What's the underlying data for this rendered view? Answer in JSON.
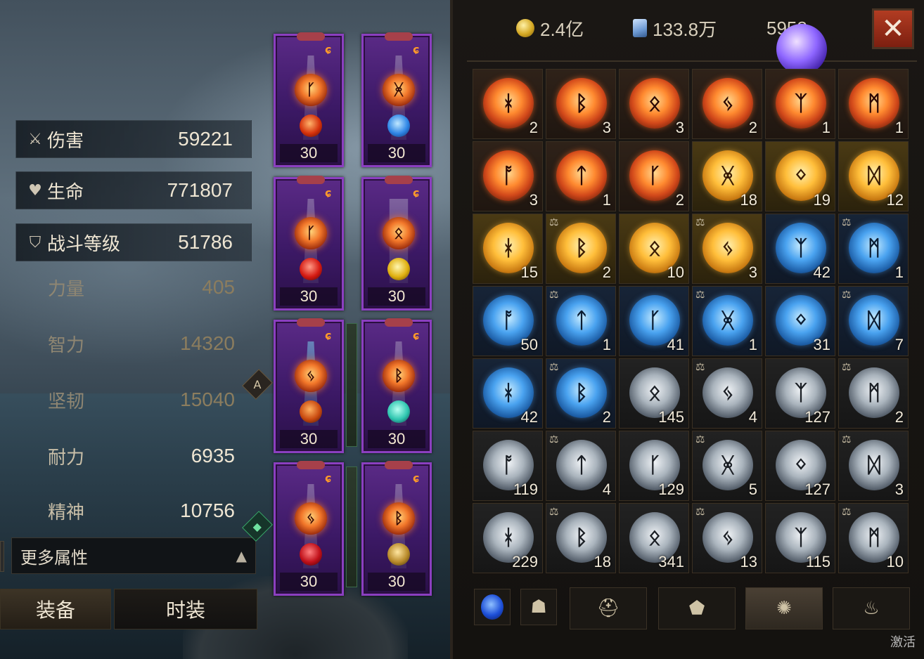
{
  "stats": {
    "main": [
      {
        "icon": "swords-icon",
        "label": "伤害",
        "value": "59221"
      },
      {
        "icon": "heart-icon",
        "label": "生命",
        "value": "771807"
      },
      {
        "icon": "shield-icon",
        "label": "战斗等级",
        "value": "51786"
      }
    ],
    "sub": [
      {
        "label": "力量",
        "value": "405",
        "dim": true
      },
      {
        "label": "智力",
        "value": "14320",
        "dim": true
      },
      {
        "label": "坚韧",
        "value": "15040",
        "dim": true
      },
      {
        "label": "耐力",
        "value": "6935",
        "dim": false
      },
      {
        "label": "精神",
        "value": "10756",
        "dim": false
      }
    ],
    "more_label": "更多属性"
  },
  "tabs": {
    "equip": "装备",
    "fashion": "时装"
  },
  "equipment": {
    "levels": [
      "30",
      "30",
      "30",
      "30",
      "30",
      "30",
      "30",
      "30"
    ],
    "side_tab_label": "A"
  },
  "currency": {
    "gold": "2.4亿",
    "card": "133.8万",
    "orb": "5958"
  },
  "close_label": "✕",
  "runes": [
    {
      "color": "red",
      "count": "2",
      "locked": false
    },
    {
      "color": "red",
      "count": "3",
      "locked": false
    },
    {
      "color": "red",
      "count": "3",
      "locked": false
    },
    {
      "color": "red",
      "count": "2",
      "locked": false
    },
    {
      "color": "red",
      "count": "1",
      "locked": false
    },
    {
      "color": "red",
      "count": "1",
      "locked": false
    },
    {
      "color": "red",
      "count": "3",
      "locked": false
    },
    {
      "color": "red",
      "count": "1",
      "locked": false
    },
    {
      "color": "red",
      "count": "2",
      "locked": false
    },
    {
      "color": "gold",
      "count": "18",
      "locked": false
    },
    {
      "color": "gold",
      "count": "19",
      "locked": false
    },
    {
      "color": "gold",
      "count": "12",
      "locked": false
    },
    {
      "color": "gold",
      "count": "15",
      "locked": false
    },
    {
      "color": "gold",
      "count": "2",
      "locked": true
    },
    {
      "color": "gold",
      "count": "10",
      "locked": false
    },
    {
      "color": "gold",
      "count": "3",
      "locked": true
    },
    {
      "color": "blue",
      "count": "42",
      "locked": false
    },
    {
      "color": "blue",
      "count": "1",
      "locked": true
    },
    {
      "color": "blue",
      "count": "50",
      "locked": false
    },
    {
      "color": "blue",
      "count": "1",
      "locked": true
    },
    {
      "color": "blue",
      "count": "41",
      "locked": false
    },
    {
      "color": "blue",
      "count": "1",
      "locked": true
    },
    {
      "color": "blue",
      "count": "31",
      "locked": false
    },
    {
      "color": "blue",
      "count": "7",
      "locked": true
    },
    {
      "color": "blue",
      "count": "42",
      "locked": false
    },
    {
      "color": "blue",
      "count": "2",
      "locked": true
    },
    {
      "color": "grey",
      "count": "145",
      "locked": false
    },
    {
      "color": "grey",
      "count": "4",
      "locked": true
    },
    {
      "color": "grey",
      "count": "127",
      "locked": false
    },
    {
      "color": "grey",
      "count": "2",
      "locked": true
    },
    {
      "color": "grey",
      "count": "119",
      "locked": false
    },
    {
      "color": "grey",
      "count": "4",
      "locked": true
    },
    {
      "color": "grey",
      "count": "129",
      "locked": false
    },
    {
      "color": "grey",
      "count": "5",
      "locked": true
    },
    {
      "color": "grey",
      "count": "127",
      "locked": false
    },
    {
      "color": "grey",
      "count": "3",
      "locked": true
    },
    {
      "color": "grey",
      "count": "229",
      "locked": false
    },
    {
      "color": "grey",
      "count": "18",
      "locked": true
    },
    {
      "color": "grey",
      "count": "341",
      "locked": false
    },
    {
      "color": "grey",
      "count": "13",
      "locked": true
    },
    {
      "color": "grey",
      "count": "115",
      "locked": false
    },
    {
      "color": "grey",
      "count": "10",
      "locked": true
    }
  ],
  "bottom_icons": [
    "blue-orb-icon",
    "demon-mask-icon",
    "helmet-icon",
    "armor-piece-icon",
    "rune-icon",
    "bag-icon"
  ],
  "watermark": "激活"
}
